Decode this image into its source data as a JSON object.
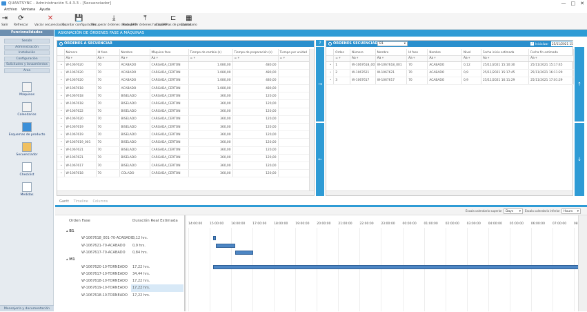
{
  "window": {
    "title": "QUANTSYNC - Administración 5.4.3.3 - [Secuenciador]",
    "controls": [
      "—",
      "□",
      "✕"
    ]
  },
  "menu": [
    "Archivo",
    "Ventana",
    "Ayuda"
  ],
  "toolbar": [
    {
      "label": "Salir",
      "icon": "exit-icon",
      "glyph": "⇥"
    },
    {
      "label": "Refrescar",
      "icon": "refresh-icon",
      "glyph": "⟳"
    },
    {
      "label": "Vaciar secuenciación",
      "icon": "clear-icon",
      "glyph": "✕"
    },
    {
      "label": "Guardar configuración",
      "icon": "save-icon",
      "glyph": "💾"
    },
    {
      "label": "Recuperar órdenes desde ERP",
      "icon": "download-icon",
      "glyph": "⤓"
    },
    {
      "label": "Recuperar órdenes hacia ERP",
      "icon": "upload-icon",
      "glyph": "⤒"
    },
    {
      "label": "Esquemas de producto",
      "icon": "schema-icon",
      "glyph": "⊏"
    },
    {
      "label": "Calendario",
      "icon": "calendar-icon",
      "glyph": "▦"
    }
  ],
  "sidebar": {
    "header": "Funcionalidades",
    "tabs": [
      "Sesión",
      "Administración",
      "Instalación",
      "Configuración",
      "Solicitudes y lanzamientos",
      "Area"
    ],
    "items": [
      "Máquinas",
      "Calendarios",
      "Esquemas de producto",
      "Secuenciador",
      "Checklist",
      "Medidas"
    ],
    "footer": "Mensajería y documentación"
  },
  "main_title": "ASIGNACIÓN DE ÓRDENES FASE A MÁQUINAS",
  "left_panel": {
    "title": "ÓRDENES A SECUENCIAR",
    "columns": [
      "Número",
      "Id fase",
      "Nombre",
      "Máquina fase",
      "Tiempo de cambio (s)",
      "Tiempo de preparación (s)",
      "Tiempo por unidad"
    ],
    "filters": [
      "Aa",
      "Aa",
      "Aa",
      "Aa",
      "=",
      "=",
      "="
    ],
    "rows": [
      [
        "W-1067620",
        "70",
        "ACABADO",
        "CARGADA_CERTON",
        "1.080,00",
        "480,00"
      ],
      [
        "W-1067620",
        "70",
        "ACABADO",
        "CARGADA_CERTON",
        "1.080,00",
        "480,00"
      ],
      [
        "W-1067620",
        "70",
        "ACABADO",
        "CARGADA_CERTON",
        "1.080,00",
        "480,00"
      ],
      [
        "W-1067618",
        "70",
        "ACABADO",
        "CARGADA_CERTON",
        "1.080,00",
        "480,00"
      ],
      [
        "W-1067618",
        "70",
        "BISELADO",
        "CARGADA_CERTON",
        "360,00",
        "120,00"
      ],
      [
        "W-1067618",
        "70",
        "BISELADO",
        "CARGADA_CERTON",
        "360,00",
        "120,00"
      ],
      [
        "W-1067622",
        "70",
        "BISELADO",
        "CARGADA_CERTON",
        "360,00",
        "120,00"
      ],
      [
        "W-1067620",
        "70",
        "BISELADO",
        "CARGADA_CERTON",
        "360,00",
        "120,00"
      ],
      [
        "W-1067619",
        "70",
        "BISELADO",
        "CARGADA_CERTON",
        "360,00",
        "120,00"
      ],
      [
        "W-1067619",
        "70",
        "BISELADO",
        "CARGADA_CERTON",
        "360,00",
        "120,00"
      ],
      [
        "W-1067619_001",
        "70",
        "BISELADO",
        "CARGADA_CERTON",
        "360,00",
        "120,00"
      ],
      [
        "W-1067621",
        "70",
        "BISELADO",
        "CARGADA_CERTON",
        "360,00",
        "120,00"
      ],
      [
        "W-1067621",
        "70",
        "BISELADO",
        "CARGADA_CERTON",
        "360,00",
        "120,00"
      ],
      [
        "W-1067617",
        "70",
        "BISELADO",
        "CARGADA_CERTON",
        "360,00",
        "120,00"
      ],
      [
        "W-1067618",
        "70",
        "COLADO",
        "CARGADA_CERTON",
        "360,00",
        "120,00"
      ]
    ]
  },
  "right_panel": {
    "title": "ÓRDENES SECUENCIADAS",
    "machine_select": "B1",
    "checkbox_label": "Inicializar",
    "datetime": "25/11/2021 15:10:30",
    "columns": [
      "Orden",
      "Número",
      "Nombre",
      "Id fase",
      "Nombre",
      "Nivel",
      "Fecha inicio estimada",
      "Fecha fin estimada"
    ],
    "rows": [
      [
        "1",
        "W-1067618_001",
        "W-1067618_001",
        "70",
        "ACABADO",
        "0,12",
        "25/11/2021 15:10:30",
        "25/11/2021 15:17:45"
      ],
      [
        "2",
        "W-1067621",
        "W-1067621",
        "70",
        "ACABADO",
        "0,9",
        "25/11/2021 15:17:45",
        "25/11/2021 16:11:29"
      ],
      [
        "3",
        "W-1067617",
        "W-1067617",
        "70",
        "ACABADO",
        "0,9",
        "25/11/2021 16:11:29",
        "25/11/2021 17:01:29"
      ]
    ]
  },
  "gantt": {
    "tabs": [
      "Gantt",
      "Timeline",
      "Columns"
    ],
    "scale_sup_label": "Escala calendario superior",
    "scale_sup": "Days",
    "scale_inf_label": "Escala calendario inferior",
    "scale_inf": "Hours",
    "col_order": "Orden Fase",
    "col_duration": "Duración Real Estimada",
    "groups": [
      {
        "name": "B1",
        "rows": [
          [
            "W-1067618_001-70-ACABADO",
            "0,12 hrs."
          ],
          [
            "W-1067621-70-ACABADO",
            "0,9 hrs."
          ],
          [
            "W-1067617-70-ACABADO",
            "0,84 hrs."
          ]
        ]
      },
      {
        "name": "M1",
        "rows": [
          [
            "W-1067620-10-TORNEADO",
            "17,22 hrs."
          ],
          [
            "W-1067617-10-TORNEADO",
            "34,44 hrs."
          ],
          [
            "W-1067618-10-TORNEADO",
            "17,22 hrs."
          ],
          [
            "W-1067619-10-TORNEADO",
            "17,22 hrs."
          ],
          [
            "W-1067618-10-TORNEADO",
            "17,22 hrs."
          ]
        ]
      }
    ],
    "ticks": [
      "14:00:00",
      "15:00:00",
      "16:00:00",
      "17:00:00",
      "18:00:00",
      "19:00:00",
      "20:00:00",
      "21:00:00",
      "22:00:00",
      "23:00:00",
      "00:00:00",
      "01:00:00",
      "02:00:00",
      "03:00:00",
      "04:00:00",
      "05:00:00",
      "06:00:00",
      "07:00:00",
      "08:00:00",
      "09:00:00",
      "10:00:00"
    ],
    "bars": [
      {
        "row": 1,
        "start_h": 15.17,
        "dur_h": 0.12
      },
      {
        "row": 2,
        "start_h": 15.3,
        "dur_h": 0.9
      },
      {
        "row": 3,
        "start_h": 16.19,
        "dur_h": 0.84
      },
      {
        "row": 5,
        "start_h": 15.17,
        "dur_h": 17.22
      },
      {
        "row": 6,
        "start_h": 32.4,
        "dur_h": 34.44
      }
    ],
    "colors": {
      "bar": "#4d86c4",
      "accent": "#2e9bd5"
    }
  }
}
